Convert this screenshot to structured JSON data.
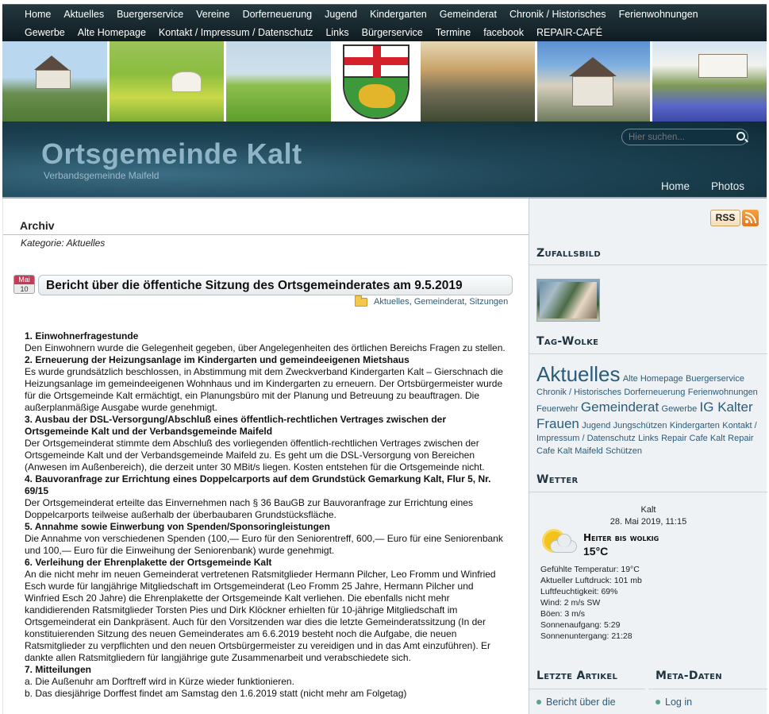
{
  "nav": {
    "row1": [
      "Home",
      "Aktuelles",
      "Buergerservice",
      "Vereine",
      "Dorferneuerung",
      "Jugend",
      "Kindergarten",
      "Gemeinderat",
      "Chronik / Historisches",
      "Ferienwohnungen"
    ],
    "row2": [
      "Gewerbe",
      "Alte Homepage",
      "Kontakt / Impressum / Datenschutz",
      "Links",
      "Bürgerservice",
      "Termine",
      "facebook",
      "REPAIR-CAFÉ"
    ]
  },
  "header": {
    "site_title": "Ortsgemeinde Kalt",
    "site_subtitle": "Verbandsgemeinde Maifeld",
    "search_placeholder": "Hier suchen...",
    "links": [
      "Home",
      "Photos"
    ]
  },
  "content": {
    "archive_title": "Archiv",
    "archive_category": "Kategorie: Aktuelles",
    "post": {
      "date_month": "Mai",
      "date_day": "10",
      "title": "Bericht über die öffentiche Sitzung des Ortsgemeinderates am 9.5.2019",
      "tags": [
        "Aktuelles",
        "Gemeinderat",
        "Sitzungen"
      ],
      "body": [
        {
          "type": "h",
          "text": "1. Einwohnerfragestunde"
        },
        {
          "type": "p",
          "text": "Den Einwohnern wurde die Gelegenheit gegeben, über Angelegenheiten des örtlichen Bereichs Fragen zu stellen."
        },
        {
          "type": "h",
          "text": "2. Erneuerung der Heizungsanlage im Kindergarten und gemeindeeigenen Mietshaus"
        },
        {
          "type": "p",
          "text": "Es wurde grundsätzlich beschlossen, in Abstimmung mit dem Zweckverband Kindergarten Kalt – Gierschnach die Heizungsanlage im gemeindeeigenen Wohnhaus und im Kindergarten zu erneuern. Der Ortsbürgermeister wurde für die Ortsgemeinde Kalt ermächtigt, ein Planungsbüro mit der Planung und Betreuung zu beauftragen. Die außerplanmäßige Ausgabe wurde genehmigt."
        },
        {
          "type": "h",
          "text": "3. Ausbau der DSL-Versorgung/Abschluß eines öffentlich-rechtlichen Vertrages zwischen der Ortsgemeinde Kalt und der Verbandsgemeinde Maifeld"
        },
        {
          "type": "p",
          "text": "Der Ortsgemeinderat stimmte dem Abschluß des vorliegenden öffentlich-rechtlichen Vertrages zwischen der Ortsgemeinde Kalt und der Verbandsgemeinde Maifeld zu. Es geht um die DSL-Versorgung von Bereichen (Anwesen im Außenbereich), die derzeit unter 30 MBit/s liegen. Kosten entstehen für die Ortsgemeinde nicht."
        },
        {
          "type": "h",
          "text": "4. Bauvoranfrage zur Errichtung eines Doppelcarports auf dem Grundstück Gemarkung Kalt, Flur 5, Nr. 69/15"
        },
        {
          "type": "p",
          "text": "Der Ortsgemeinderat erteilte das Einvernehmen nach § 36 BauGB zur Bauvoranfrage zur Errichtung eines Doppelcarports teilweise außerhalb der überbaubaren Grundstücksfläche."
        },
        {
          "type": "h",
          "text": "5. Annahme sowie Einwerbung von Spenden/Sponsoringleistungen"
        },
        {
          "type": "p",
          "text": "Die Annahme von verschiedenen Spenden (100,— Euro für den Seniorentreff, 600,— Euro für eine Seniorenbank und 100,— Euro für die Einweihung der Seniorenbank) wurde genehmigt."
        },
        {
          "type": "h",
          "text": "6. Verleihung der Ehrenplakette der Ortsgemeinde Kalt"
        },
        {
          "type": "p",
          "text": "An die nicht mehr im neuen Gemeinderat vertretenen Ratsmitglieder Hermann Pilcher, Leo Fromm und Winfried Esch wurde für langjährige Mitgliedschaft im Ortsgemeinderat (Leo Fromm 25 Jahre, Hermann Pilcher und Winfried Esch 20 Jahre) die Ehrenplakette der Ortsgemeinde Kalt verliehen. Die ebenfalls nicht mehr kandidierenden Ratsmitglieder Torsten Pies und Dirk Klöckner erhielten für 10-jährige Mitgliedschaft im Ortsgemeinderat ein Dankpräsent. Auch für den Vorsitzenden war dies die letzte Gemeinderatssitzung (In der konstituierenden Sitzung des neuen Gemeinderates am 6.6.2019 besteht noch die Aufgabe, die neuen Ratsmitglieder zu verpflichten und den neuen Ortsbürgermeister zu vereidigen und in das Amt einzuführen). Er dankte allen Ratsmitgliedern für langjährige gute Zusammenarbeit und verabschiedete sich."
        },
        {
          "type": "h",
          "text": "7. Mitteilungen"
        },
        {
          "type": "p",
          "text": "a. Die Außenuhr am Dorftreff wird in Kürze wieder funktionieren."
        },
        {
          "type": "p",
          "text": "b. Das diesjährige Dorffest findet am Samstag den 1.6.2019 statt (nicht mehr am Folgetag)"
        }
      ]
    }
  },
  "sidebar": {
    "rss_label": "RSS",
    "random_title": "Zufallsbild",
    "tagcloud_title": "Tag-Wolke",
    "tags": [
      {
        "text": "Aktuelles",
        "size": 26
      },
      {
        "text": "Alte Homepage",
        "size": 11
      },
      {
        "text": "Buergerservice",
        "size": 11
      },
      {
        "text": "Chronik / Historisches",
        "size": 11
      },
      {
        "text": "Dorferneuerung",
        "size": 11
      },
      {
        "text": "Ferienwohnungen",
        "size": 11
      },
      {
        "text": "Feuerwehr",
        "size": 11
      },
      {
        "text": "Gemeinderat",
        "size": 17
      },
      {
        "text": "Gewerbe",
        "size": 11
      },
      {
        "text": "IG Kalter Frauen",
        "size": 17
      },
      {
        "text": "Jugend",
        "size": 11
      },
      {
        "text": "Jungschützen",
        "size": 11
      },
      {
        "text": "Kindergarten",
        "size": 11
      },
      {
        "text": "Kontakt / Impressum / Datenschutz",
        "size": 11
      },
      {
        "text": "Links",
        "size": 11
      },
      {
        "text": "Repair Cafe Kalt",
        "size": 11
      },
      {
        "text": "Repair Cafe Kalt Maifeld",
        "size": 11
      },
      {
        "text": "Schützen",
        "size": 11
      }
    ],
    "weather": {
      "title": "Wetter",
      "place": "Kalt",
      "datetime": "28. Mai 2019, 11:15",
      "condition": "Heiter bis wolkig",
      "temperature": "15°C",
      "details": [
        "Gefühlte Temperatur: 19°C",
        "Aktueller Luftdruck: 101 mb",
        "Luftfeuchtigkeit: 69%",
        "Wind: 2 m/s SW",
        "Böen: 3 m/s",
        "Sonnenaufgang: 5:29",
        "Sonnenuntergang: 21:28"
      ]
    },
    "latest_title": "Letzte Artikel",
    "latest_first": "Bericht über die",
    "meta_title": "Meta-Daten",
    "meta_first": "Log in"
  }
}
